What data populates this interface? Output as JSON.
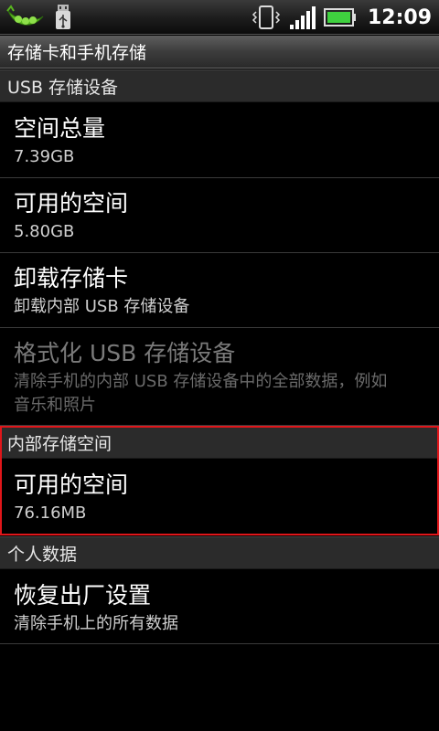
{
  "status_bar": {
    "time": "12:09",
    "icons": [
      "pea-pod-icon",
      "usb-icon",
      "vibrate-icon",
      "signal-icon",
      "battery-icon"
    ]
  },
  "title": "存储卡和手机存储",
  "usb_section": {
    "header": "USB 存储设备",
    "items": [
      {
        "title": "空间总量",
        "subtitle": "7.39GB"
      },
      {
        "title": "可用的空间",
        "subtitle": "5.80GB"
      },
      {
        "title": "卸载存储卡",
        "subtitle": "卸载内部 USB 存储设备"
      },
      {
        "title": "格式化 USB 存储设备",
        "subtitle_line1": "清除手机的内部 USB 存储设备中的全部数据，例如",
        "subtitle_line2": "音乐和照片"
      }
    ]
  },
  "internal_section": {
    "header": "内部存储空间",
    "items": [
      {
        "title": "可用的空间",
        "subtitle": "76.16MB"
      }
    ]
  },
  "personal_section": {
    "header": "个人数据",
    "items": [
      {
        "title": "恢复出厂设置",
        "subtitle": "清除手机上的所有数据"
      }
    ]
  },
  "colors": {
    "background": "#000000",
    "highlight_border": "#e0161a",
    "battery": "#3fd13f"
  }
}
